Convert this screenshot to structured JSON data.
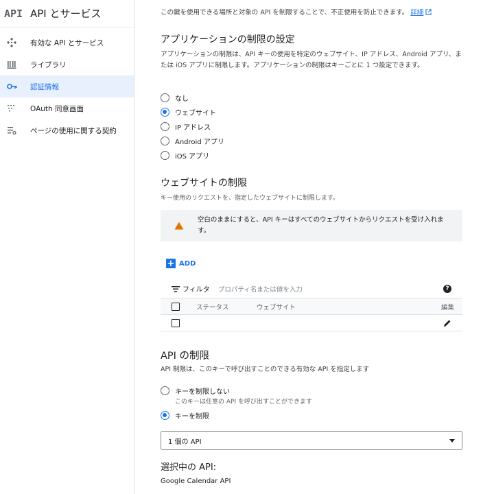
{
  "sidebar": {
    "logo": "API",
    "title": "API とサービス",
    "items": [
      {
        "label": "有効な API とサービス",
        "icon": "dashboard-icon"
      },
      {
        "label": "ライブラリ",
        "icon": "library-icon"
      },
      {
        "label": "認証情報",
        "icon": "key-icon"
      },
      {
        "label": "OAuth 同意画面",
        "icon": "consent-screen-icon"
      },
      {
        "label": "ページの使用に関する契約",
        "icon": "agreement-icon"
      }
    ],
    "active_index": 2
  },
  "main": {
    "notice_text": "この鍵を使用できる場所と対象の API を制限することで、不正使用を防止できます。",
    "notice_link": "詳細",
    "app_restrictions": {
      "title": "アプリケーションの制限の設定",
      "description": "アプリケーションの制限は、API キーの使用を特定のウェブサイト、IP アドレス、Android アプリ、または iOS アプリに制限します。アプリケーションの制限はキーごとに 1 つ設定できます。",
      "options": [
        "なし",
        "ウェブサイト",
        "IP アドレス",
        "Android アプリ",
        "iOS アプリ"
      ],
      "selected_index": 1
    },
    "website_restrictions": {
      "title": "ウェブサイトの制限",
      "description": "キー使用のリクエストを、指定したウェブサイトに制限します。",
      "warning": "空白のままにすると、API キーはすべてのウェブサイトからリクエストを受け入れます。",
      "add_label": "ADD",
      "filter_label": "フィルタ",
      "filter_placeholder": "プロパティ名または値を入力",
      "columns": [
        "ステータス",
        "ウェブサイト",
        "編集"
      ]
    },
    "api_restrictions": {
      "title": "API の制限",
      "description": "API 制限は、このキーで呼び出すことのできる有効な API を指定します",
      "options": [
        {
          "label": "キーを制限しない",
          "sub": "このキーは任意の API を呼び出すことができます"
        },
        {
          "label": "キーを制限",
          "sub": ""
        }
      ],
      "selected_index": 1,
      "select_value": "1 個の API",
      "selected_title": "選択中の API:",
      "selected_apis": [
        "Google Calendar API"
      ]
    }
  },
  "colors": {
    "accent": "#1a73e8",
    "warning": "#e37400",
    "active_bg": "#e8f0fe"
  }
}
